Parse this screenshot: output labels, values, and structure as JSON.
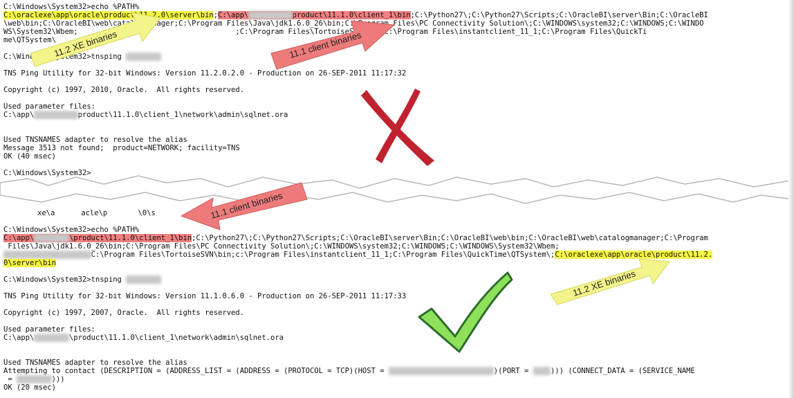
{
  "top": {
    "line1_prompt": "C:\\Windows\\System32>echo %PATH%",
    "line2_hl_yellow": "C:\\oraclexe\\app\\oracle\\product\\11.2.0\\server\\bin",
    "line2_sep": ";",
    "line2_hl_red_a": "C:\\app\\",
    "line2_hl_red_b": "product\\11.1.0\\client_1\\bin",
    "line2_rest": ";C:\\Python27\\;C:\\Python27\\Scripts;C:\\OracleBI\\server\\Bin;C:\\OracleBI",
    "line3": "\\web\\bin;C:\\OracleBI\\web\\catalogmanager;C:\\Program Files\\Java\\jdk1.6.0_26\\bin;C:\\Program Files\\PC Connectivity Solution\\;C:\\WINDOWS\\system32;C:\\WINDOWS;C:\\WINDO",
    "line4": "WS\\System32\\Wbem;                                    ;C:\\Program Files\\TortoiseSVN\\bin;c:\\Program Files\\instantclient_11_1;C:\\Program Files\\QuickTi",
    "line5": "me\\QTSystem\\",
    "tnsping_cmd": "C:\\Windows\\System32>tnsping ",
    "tns_version": "TNS Ping Utility for 32-bit Windows: Version 11.2.0.2.0 - Production on 26-SEP-2011 11:17:32",
    "copyright": "Copyright (c) 1997, 2010, Oracle.  All rights reserved.",
    "used_params": "Used parameter files:",
    "sqlnet_a": "C:\\app\\",
    "sqlnet_b": "product\\11.1.0\\client_1\\network\\admin\\sqlnet.ora",
    "adapter": "Used TNSNAMES adapter to resolve the alias",
    "message": "Message 3513 not found;  product=NETWORK; facility=TNS",
    "ok": "OK (40 msec)",
    "prompt_end": "C:\\Windows\\System32>"
  },
  "bottom": {
    "fragment": "xe\\a      acle\\p       \\0\\s",
    "line1_prompt": "C:\\Windows\\System32>echo %PATH%",
    "line2_hl_red_a": "C:\\app\\",
    "line2_hl_red_b": "\\product\\11.1.0\\client_1\\bin",
    "line2_rest": ";C:\\Python27\\;C:\\Python27\\Scripts;C:\\OracleBI\\server\\Bin;C:\\OracleBI\\web\\bin;C:\\OracleBI\\web\\catalogmanager;C:\\Program",
    "line3": " Files\\Java\\jdk1.6.0_26\\bin;C:\\Program Files\\PC Connectivity Solution\\;C:\\WINDOWS\\system32;C:\\WINDOWS;C:\\WINDOWS\\System32\\Wbem;",
    "line4_pre": "C:\\Program Files\\TortoiseSVN\\bin;c:\\Program Files\\instantclient_11_1;C:\\Program Files\\QuickTime\\QTSystem\\;",
    "line4_hl": "C:\\oraclexe\\app\\oracle\\product\\11.2.",
    "line5_hl": "0\\server\\bin",
    "tnsping_cmd": "C:\\Windows\\System32>tnsping ",
    "tns_version": "TNS Ping Utility for 32-bit Windows: Version 11.1.0.6.0 - Production on 26-SEP-2011 11:17:33",
    "copyright": "Copyright (c) 1997, 2007, Oracle.  All rights reserved.",
    "used_params": "Used parameter files:",
    "sqlnet_a": "C:\\app\\",
    "sqlnet_b": "\\product\\11.1.0\\client_1\\network\\admin\\sqlnet.ora",
    "adapter": "Used TNSNAMES adapter to resolve the alias",
    "attempt_a": "Attempting to contact (DESCRIPTION = (ADDRESS_LIST = (ADDRESS = (PROTOCOL = TCP)(HOST = ",
    "attempt_b": ")(PORT = ",
    "attempt_c": "))) (CONNECT_DATA = (SERVICE_NAME",
    "attempt2_a": " = ",
    "attempt2_b": ")))",
    "ok": "OK (20 msec)"
  },
  "annotations": {
    "xe_top": "11.2 XE binaries",
    "client_top": "11.1 client binaries",
    "client_mid": "11.1 client binaries",
    "xe_bottom": "11.2 XE binaries"
  },
  "colors": {
    "yellow_highlight": "#f5f542",
    "red_highlight": "#f08080",
    "yellow_arrow": "#f3f58a",
    "red_arrow": "#ee7b7b",
    "cross": "#c0222f",
    "check": "#8fe05a"
  }
}
